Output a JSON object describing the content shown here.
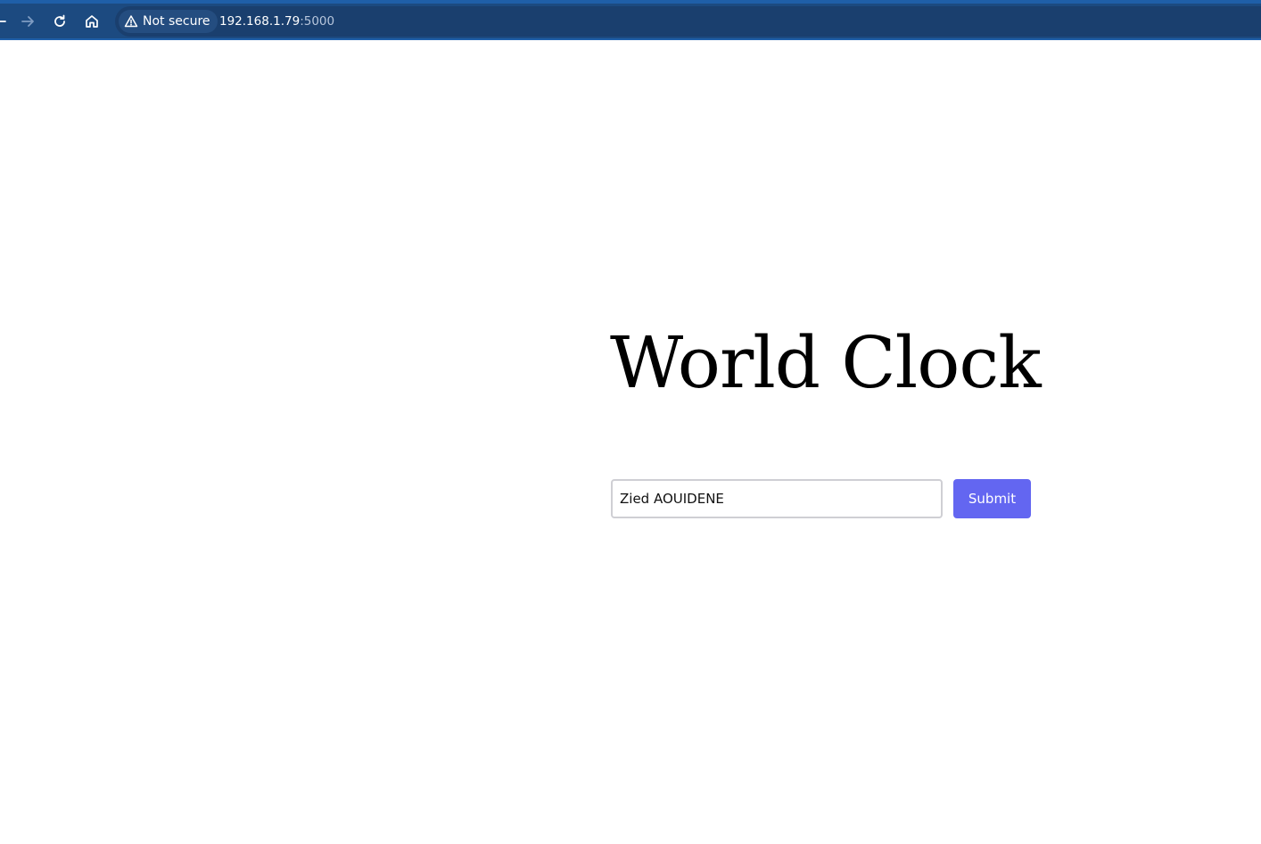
{
  "browser": {
    "security_label": "Not secure",
    "url_host": "192.168.1.79",
    "url_port": ":5000"
  },
  "page": {
    "title": "World Clock",
    "input_value": "Zied AOUIDENE",
    "submit_label": "Submit"
  },
  "colors": {
    "toolbar": "#1c4a80",
    "accent_button": "#6366f1"
  }
}
